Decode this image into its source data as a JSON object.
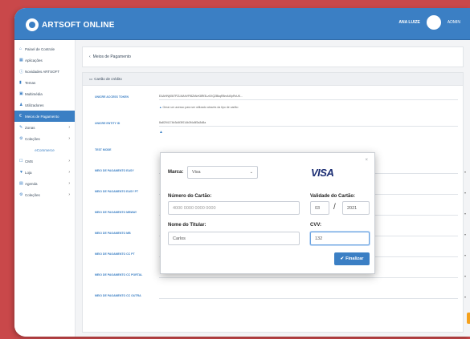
{
  "app": {
    "logo_text": "ARTSOFT ONLINE"
  },
  "header": {
    "user_name": "ANA LUIZE",
    "user_role": "ADMIN"
  },
  "sidebar": {
    "items": [
      {
        "icon": "home-icon",
        "label": "Painel de Controle",
        "glyph": "⌂"
      },
      {
        "icon": "apps-icon",
        "label": "Aplicações",
        "glyph": "▦"
      },
      {
        "icon": "info-icon",
        "label": "Novidades ARTSOFT",
        "glyph": "ⓘ"
      },
      {
        "icon": "themes-icon",
        "label": "Temas",
        "glyph": "▮"
      },
      {
        "icon": "multimedia-icon",
        "label": "Multimédia",
        "glyph": "▣"
      },
      {
        "icon": "users-icon",
        "label": "Utilizadores",
        "glyph": "♟"
      },
      {
        "icon": "payment-icon",
        "label": "Meios de Pagamento",
        "glyph": "€"
      },
      {
        "icon": "zones-icon",
        "label": "Zonas",
        "glyph": "✎"
      },
      {
        "icon": "collections-icon",
        "label": "Coleções",
        "glyph": "⚙"
      },
      {
        "icon": "",
        "label": "eCommerce",
        "glyph": ""
      },
      {
        "icon": "cms-icon",
        "label": "CMS",
        "glyph": "☐"
      },
      {
        "icon": "store-icon",
        "label": "Loja",
        "glyph": "▼"
      },
      {
        "icon": "agenda-icon",
        "label": "Agenda",
        "glyph": "▤"
      },
      {
        "icon": "settings-icon",
        "label": "Coleções",
        "glyph": "⚙"
      }
    ]
  },
  "breadcrumb": {
    "label": "Meios de Pagamento"
  },
  "panel": {
    "title": "Cartão de crédito",
    "rows": [
      {
        "label": "UNICRE ACCESS TOKEN",
        "value": "EAAHNjK5t7PZLMAhVFf8ZkNrK8Rf3Lz0XQ2BkqR8mAtXpRvUK...",
        "info": "Gerar um acesso para ser utilizado através da tipo de cartão"
      },
      {
        "label": "UNICRE ENTITY ID",
        "value": "8a8294174b3d4f3f014b3f4c8f3a3d8a",
        "info": ""
      },
      {
        "label": "TEST MODE",
        "value": "",
        "info": ""
      },
      {
        "label": "MEIO DE PAGAMENTO EASY",
        "value": "",
        "info": ""
      },
      {
        "label": "MEIO DE PAGAMENTO EASY PT",
        "value": "",
        "info": ""
      },
      {
        "label": "MEIO DE PAGAMENTO MBWAY",
        "value": "",
        "info": ""
      },
      {
        "label": "MEIO DE PAGAMENTO MB",
        "value": "",
        "info": ""
      },
      {
        "label": "MEIO DE PAGAMENTO CC PT",
        "value": "",
        "info": ""
      },
      {
        "label": "MEIO DE PAGAMENTO CC PORTAL",
        "value": "",
        "info": ""
      },
      {
        "label": "MEIO DE PAGAMENTO CC OUTRA",
        "value": "",
        "info": ""
      }
    ]
  },
  "modal": {
    "brand_label": "Marca:",
    "brand_value": "Visa",
    "brand_logo": "VISA",
    "card_number_label": "Número do Cartão:",
    "card_number_placeholder": "4000 0000 0000 0000",
    "validity_label": "Validade do Cartão:",
    "validity_month": "03",
    "validity_year": "2021",
    "holder_label": "Nome do Titular:",
    "holder_value": "Carlos",
    "cvv_label": "CVV:",
    "cvv_value": "132",
    "finish_label": "Finalizar",
    "close_glyph": "×"
  },
  "colors": {
    "accent": "#3b7fc4",
    "background": "#c9484a",
    "warning": "#f5a11c",
    "visa": "#1a2c72"
  }
}
